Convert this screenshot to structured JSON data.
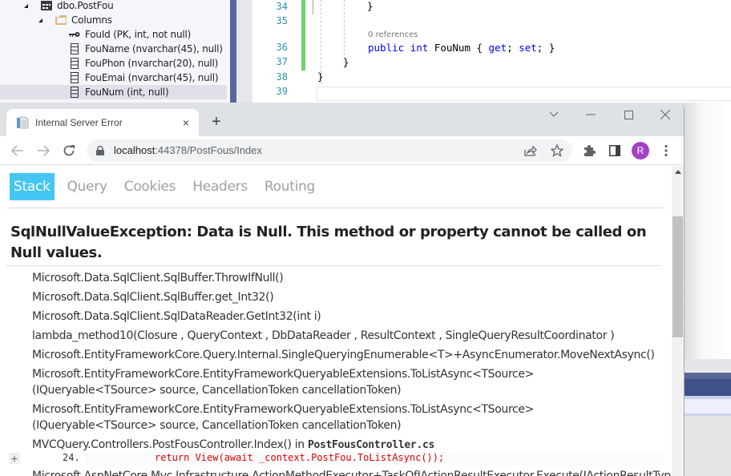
{
  "vs": {
    "tree": {
      "table": "dbo.PostFou",
      "folder": "Columns",
      "columns": [
        {
          "label": "FouId (PK, int, not null)",
          "icon": "key-icon"
        },
        {
          "label": "FouName (nvarchar(45), null)",
          "icon": "column-icon"
        },
        {
          "label": "FouPhon (nvarchar(20), null)",
          "icon": "column-icon"
        },
        {
          "label": "FouEmai (nvarchar(45), null)",
          "icon": "column-icon"
        },
        {
          "label": "FouNum (int, null)",
          "icon": "column-icon",
          "selected": true
        }
      ]
    },
    "editor": {
      "line_numbers": [
        "34",
        "35",
        "36",
        "37",
        "38",
        "39"
      ],
      "codelens": "0 references",
      "lines": {
        "l34": "}",
        "l36_kw1": "public",
        "l36_kw2": "int",
        "l36_name": "FouNum",
        "l36_open": "{",
        "l36_get": "get",
        "l36_set": "set",
        "l36_close": "}",
        "l37": "}",
        "l38": "}"
      },
      "change_bar_color": "#6ad36a"
    }
  },
  "browser": {
    "tab": {
      "title": "Internal Server Error",
      "close": "×"
    },
    "new_tab": "+",
    "window_controls": {
      "tab_search": "chevron-down-icon",
      "minimize": "minimize-icon",
      "maximize": "maximize-icon",
      "close": "close-icon"
    },
    "url_host": "localhost",
    "url_path": ":44378/PostFous/Index",
    "profile_initial": "R",
    "profile_color": "#a142c7"
  },
  "page": {
    "tabs": [
      {
        "label": "Stack",
        "active": true
      },
      {
        "label": "Query",
        "active": false
      },
      {
        "label": "Cookies",
        "active": false
      },
      {
        "label": "Headers",
        "active": false
      },
      {
        "label": "Routing",
        "active": false
      }
    ],
    "active_tab_color": "#44c5f2",
    "error_title": "SqlNullValueException: Data is Null. This method or property cannot be called on Null values.",
    "frames": [
      {
        "text": "Microsoft.Data.SqlClient.SqlBuffer.ThrowIfNull()"
      },
      {
        "text": "Microsoft.Data.SqlClient.SqlBuffer.get_Int32()"
      },
      {
        "text": "Microsoft.Data.SqlClient.SqlDataReader.GetInt32(int i)"
      },
      {
        "text": "lambda_method10(Closure , QueryContext , DbDataReader , ResultContext , SingleQueryResultCoordinator )"
      },
      {
        "text": "Microsoft.EntityFrameworkCore.Query.Internal.SingleQueryingEnumerable<T>+AsyncEnumerator.MoveNextAsync()"
      },
      {
        "text": "Microsoft.EntityFrameworkCore.EntityFrameworkQueryableExtensions.ToListAsync<TSource>(IQueryable<TSource> source, CancellationToken cancellationToken)"
      },
      {
        "text": "Microsoft.EntityFrameworkCore.EntityFrameworkQueryableExtensions.ToListAsync<TSource>(IQueryable<TSource> source, CancellationToken cancellationToken)"
      },
      {
        "text": "MVCQuery.Controllers.PostFousController.Index() in ",
        "file": "PostFousController.cs"
      }
    ],
    "code_line": {
      "expand": "+",
      "number": "24.",
      "code": "return View(await _context.PostFou.ToListAsync());"
    },
    "cut_frame": "Microsoft.AspNetCore.Mvc.Infrastructure.ActionMethodExecutor+TaskOfIActionResultExecutor.Execute(IActionResultTyp"
  }
}
